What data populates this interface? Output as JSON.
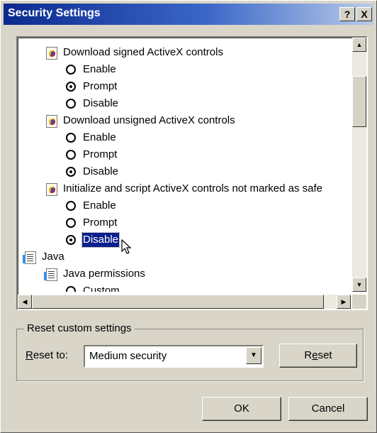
{
  "window": {
    "title": "Security Settings",
    "help_button": "?",
    "close_button": "X"
  },
  "settings_list": {
    "categories": [
      {
        "label": "Download signed ActiveX controls",
        "icon": "activex-settings-icon",
        "options": [
          {
            "label": "Enable",
            "checked": false
          },
          {
            "label": "Prompt",
            "checked": true
          },
          {
            "label": "Disable",
            "checked": false
          }
        ]
      },
      {
        "label": "Download unsigned ActiveX controls",
        "icon": "activex-settings-icon",
        "options": [
          {
            "label": "Enable",
            "checked": false
          },
          {
            "label": "Prompt",
            "checked": false
          },
          {
            "label": "Disable",
            "checked": true
          }
        ]
      },
      {
        "label": "Initialize and script ActiveX controls not marked as safe",
        "icon": "activex-settings-icon",
        "options": [
          {
            "label": "Enable",
            "checked": false
          },
          {
            "label": "Prompt",
            "checked": false
          },
          {
            "label": "Disable",
            "checked": true,
            "selected": true
          }
        ]
      }
    ],
    "java": {
      "label": "Java",
      "icon": "java-icon",
      "permissions": {
        "label": "Java permissions",
        "icon": "java-permissions-icon",
        "options": [
          {
            "label": "Custom",
            "checked": false
          }
        ]
      }
    }
  },
  "reset_group": {
    "title": "Reset custom settings",
    "label_prefix": "R",
    "label_rest": "eset to:",
    "selected_value": "Medium security",
    "button_prefix": "R",
    "button_underlined": "e",
    "button_rest": "set"
  },
  "footer": {
    "ok_label": "OK",
    "cancel_label": "Cancel"
  }
}
